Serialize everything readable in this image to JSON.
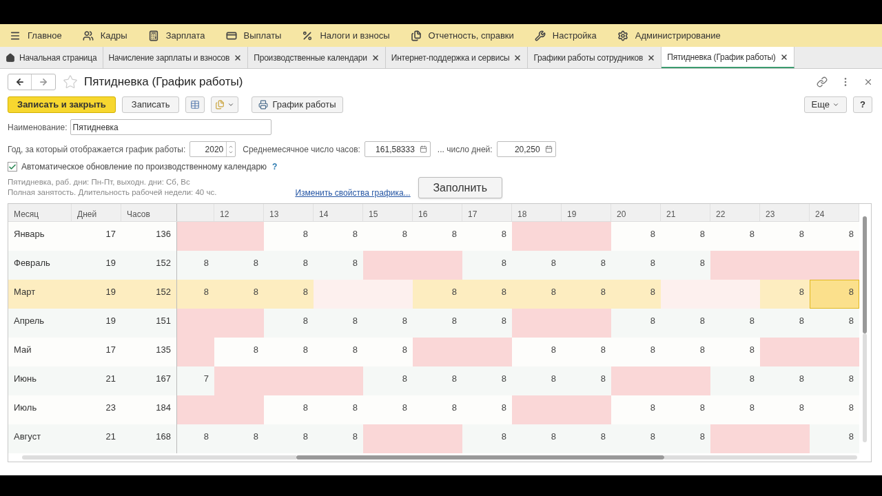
{
  "menu": [
    {
      "label": "Главное"
    },
    {
      "label": "Кадры"
    },
    {
      "label": "Зарплата"
    },
    {
      "label": "Выплаты"
    },
    {
      "label": "Налоги и взносы"
    },
    {
      "label": "Отчетность, справки"
    },
    {
      "label": "Настройка"
    },
    {
      "label": "Администрирование"
    }
  ],
  "tabs": [
    {
      "label": "Начальная страница",
      "kind": "home",
      "selected": false
    },
    {
      "label": "Начисление зарплаты и взносов",
      "kind": "page",
      "selected": false
    },
    {
      "label": "Производственные календари",
      "kind": "page",
      "selected": false
    },
    {
      "label": "Интернет-поддержка и сервисы",
      "kind": "page",
      "selected": false
    },
    {
      "label": "Графики работы сотрудников",
      "kind": "page",
      "selected": false
    },
    {
      "label": "Пятидневка (График работы)",
      "kind": "page",
      "selected": true
    }
  ],
  "form": {
    "title": "Пятидневка (График работы)",
    "starred": false,
    "buttons": {
      "save_close": "Записать и закрыть",
      "save": "Записать",
      "print": "График работы",
      "more": "Еще",
      "help": "?"
    },
    "name_label": "Наименование:",
    "name_value": "Пятидневка",
    "year_label": "Год, за который отображается график работы:",
    "year_value": "2020",
    "hours_label": "Среднемесячное число часов:",
    "hours_value": "161,58333",
    "days_label": "... число дней:",
    "days_value": "20,250",
    "auto_update": {
      "label": "Автоматическое обновление по производственному календарю",
      "checked": true,
      "help": "?"
    },
    "info": [
      "Пятидневка, раб. дни: Пн-Пт, выходн. дни: Сб, Вс",
      "Полная занятость. Длительность рабочей недели: 40 чс."
    ],
    "change_link": "Изменить свойства графика...",
    "fill_button": "Заполнить"
  },
  "table": {
    "columns": [
      "Месяц",
      "Дней",
      "Часов"
    ],
    "day_columns": [
      "12",
      "13",
      "14",
      "15",
      "16",
      "17",
      "18",
      "19",
      "20",
      "21",
      "22",
      "23",
      "24"
    ],
    "rows": [
      {
        "month": "Январь",
        "days": "17",
        "hours": "136",
        "selected": false,
        "cells": [
          {
            "holiday": true,
            "selected": false
          },
          {
            "holiday": true,
            "selected": false
          },
          {
            "value": "8",
            "holiday": false,
            "selected": false
          },
          {
            "value": "8",
            "holiday": false,
            "selected": false
          },
          {
            "value": "8",
            "holiday": false,
            "selected": false
          },
          {
            "value": "8",
            "holiday": false,
            "selected": false
          },
          {
            "value": "8",
            "holiday": false,
            "selected": false
          },
          {
            "holiday": true,
            "selected": false
          },
          {
            "holiday": true,
            "selected": false
          },
          {
            "value": "8",
            "holiday": false,
            "selected": false
          },
          {
            "value": "8",
            "holiday": false,
            "selected": false
          },
          {
            "value": "8",
            "holiday": false,
            "selected": false
          },
          {
            "value": "8",
            "holiday": false,
            "selected": false
          },
          {
            "value": "8",
            "holiday": false,
            "selected": false
          }
        ]
      },
      {
        "month": "Февраль",
        "days": "19",
        "hours": "152",
        "selected": false,
        "cells": [
          {
            "value": "8",
            "holiday": false,
            "selected": false
          },
          {
            "value": "8",
            "holiday": false,
            "selected": false
          },
          {
            "value": "8",
            "holiday": false,
            "selected": false
          },
          {
            "value": "8",
            "holiday": false,
            "selected": false
          },
          {
            "holiday": true,
            "selected": false
          },
          {
            "holiday": true,
            "selected": false
          },
          {
            "value": "8",
            "holiday": false,
            "selected": false
          },
          {
            "value": "8",
            "holiday": false,
            "selected": false
          },
          {
            "value": "8",
            "holiday": false,
            "selected": false
          },
          {
            "value": "8",
            "holiday": false,
            "selected": false
          },
          {
            "value": "8",
            "holiday": false,
            "selected": false
          },
          {
            "holiday": true,
            "selected": false
          },
          {
            "holiday": true,
            "selected": false
          },
          {
            "holiday": true,
            "selected": false
          }
        ]
      },
      {
        "month": "Март",
        "days": "19",
        "hours": "152",
        "selected": true,
        "cells": [
          {
            "value": "8",
            "holiday": false,
            "selected": false
          },
          {
            "value": "8",
            "holiday": false,
            "selected": false
          },
          {
            "value": "8",
            "holiday": false,
            "selected": false
          },
          {
            "holiday": true,
            "selected": false
          },
          {
            "holiday": true,
            "selected": false
          },
          {
            "value": "8",
            "holiday": false,
            "selected": false
          },
          {
            "value": "8",
            "holiday": false,
            "selected": false
          },
          {
            "value": "8",
            "holiday": false,
            "selected": false
          },
          {
            "value": "8",
            "holiday": false,
            "selected": false
          },
          {
            "value": "8",
            "holiday": false,
            "selected": false
          },
          {
            "holiday": true,
            "selected": false
          },
          {
            "holiday": true,
            "selected": false
          },
          {
            "value": "8",
            "holiday": false,
            "selected": false
          },
          {
            "value": "8",
            "holiday": false,
            "selected": true
          }
        ]
      },
      {
        "month": "Апрель",
        "days": "19",
        "hours": "151",
        "selected": false,
        "cells": [
          {
            "holiday": true,
            "selected": false
          },
          {
            "holiday": true,
            "selected": false
          },
          {
            "value": "8",
            "holiday": false,
            "selected": false
          },
          {
            "value": "8",
            "holiday": false,
            "selected": false
          },
          {
            "value": "8",
            "holiday": false,
            "selected": false
          },
          {
            "value": "8",
            "holiday": false,
            "selected": false
          },
          {
            "value": "8",
            "holiday": false,
            "selected": false
          },
          {
            "holiday": true,
            "selected": false
          },
          {
            "holiday": true,
            "selected": false
          },
          {
            "value": "8",
            "holiday": false,
            "selected": false
          },
          {
            "value": "8",
            "holiday": false,
            "selected": false
          },
          {
            "value": "8",
            "holiday": false,
            "selected": false
          },
          {
            "value": "8",
            "holiday": false,
            "selected": false
          },
          {
            "value": "8",
            "holiday": false,
            "selected": false
          }
        ]
      },
      {
        "month": "Май",
        "days": "17",
        "hours": "135",
        "selected": false,
        "cells": [
          {
            "holiday": true,
            "selected": false
          },
          {
            "value": "8",
            "holiday": false,
            "selected": false
          },
          {
            "value": "8",
            "holiday": false,
            "selected": false
          },
          {
            "value": "8",
            "holiday": false,
            "selected": false
          },
          {
            "value": "8",
            "holiday": false,
            "selected": false
          },
          {
            "holiday": true,
            "selected": false
          },
          {
            "holiday": true,
            "selected": false
          },
          {
            "value": "8",
            "holiday": false,
            "selected": false
          },
          {
            "value": "8",
            "holiday": false,
            "selected": false
          },
          {
            "value": "8",
            "holiday": false,
            "selected": false
          },
          {
            "value": "8",
            "holiday": false,
            "selected": false
          },
          {
            "value": "8",
            "holiday": false,
            "selected": false
          },
          {
            "holiday": true,
            "selected": false
          },
          {
            "holiday": true,
            "selected": false
          }
        ]
      },
      {
        "month": "Июнь",
        "days": "21",
        "hours": "167",
        "selected": false,
        "cells": [
          {
            "value": "7",
            "holiday": false,
            "selected": false
          },
          {
            "holiday": true,
            "selected": false
          },
          {
            "holiday": true,
            "selected": false
          },
          {
            "holiday": true,
            "selected": false
          },
          {
            "value": "8",
            "holiday": false,
            "selected": false
          },
          {
            "value": "8",
            "holiday": false,
            "selected": false
          },
          {
            "value": "8",
            "holiday": false,
            "selected": false
          },
          {
            "value": "8",
            "holiday": false,
            "selected": false
          },
          {
            "value": "8",
            "holiday": false,
            "selected": false
          },
          {
            "holiday": true,
            "selected": false
          },
          {
            "holiday": true,
            "selected": false
          },
          {
            "value": "8",
            "holiday": false,
            "selected": false
          },
          {
            "value": "8",
            "holiday": false,
            "selected": false
          },
          {
            "value": "8",
            "holiday": false,
            "selected": false
          }
        ]
      },
      {
        "month": "Июль",
        "days": "23",
        "hours": "184",
        "selected": false,
        "cells": [
          {
            "holiday": true,
            "selected": false
          },
          {
            "holiday": true,
            "selected": false
          },
          {
            "value": "8",
            "holiday": false,
            "selected": false
          },
          {
            "value": "8",
            "holiday": false,
            "selected": false
          },
          {
            "value": "8",
            "holiday": false,
            "selected": false
          },
          {
            "value": "8",
            "holiday": false,
            "selected": false
          },
          {
            "value": "8",
            "holiday": false,
            "selected": false
          },
          {
            "holiday": true,
            "selected": false
          },
          {
            "holiday": true,
            "selected": false
          },
          {
            "value": "8",
            "holiday": false,
            "selected": false
          },
          {
            "value": "8",
            "holiday": false,
            "selected": false
          },
          {
            "value": "8",
            "holiday": false,
            "selected": false
          },
          {
            "value": "8",
            "holiday": false,
            "selected": false
          },
          {
            "value": "8",
            "holiday": false,
            "selected": false
          }
        ]
      },
      {
        "month": "Август",
        "days": "21",
        "hours": "168",
        "selected": false,
        "cells": [
          {
            "value": "8",
            "holiday": false,
            "selected": false
          },
          {
            "value": "8",
            "holiday": false,
            "selected": false
          },
          {
            "value": "8",
            "holiday": false,
            "selected": false
          },
          {
            "value": "8",
            "holiday": false,
            "selected": false
          },
          {
            "holiday": true,
            "selected": false
          },
          {
            "holiday": true,
            "selected": false
          },
          {
            "value": "8",
            "holiday": false,
            "selected": false
          },
          {
            "value": "8",
            "holiday": false,
            "selected": false
          },
          {
            "value": "8",
            "holiday": false,
            "selected": false
          },
          {
            "value": "8",
            "holiday": false,
            "selected": false
          },
          {
            "value": "8",
            "holiday": false,
            "selected": false
          },
          {
            "holiday": true,
            "selected": false
          },
          {
            "holiday": true,
            "selected": false
          },
          {
            "value": "8",
            "holiday": false,
            "selected": false
          }
        ]
      }
    ]
  }
}
